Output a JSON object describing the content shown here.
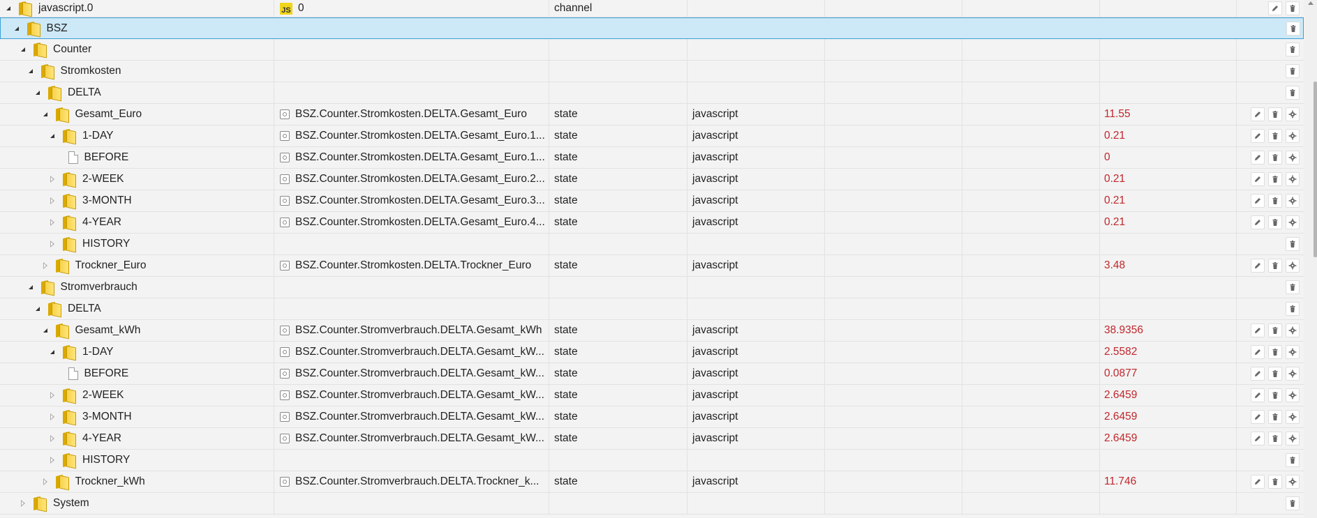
{
  "rows": [
    {
      "name": "javascript.0",
      "level": 0,
      "exp": "open",
      "icon": "folder",
      "idIcon": "js",
      "id": "0",
      "type": "channel",
      "role": "",
      "value": "",
      "buttons": [
        "edit",
        "delete"
      ],
      "first": true
    },
    {
      "name": "BSZ",
      "level": 1,
      "exp": "open",
      "icon": "folder",
      "id": "",
      "type": "",
      "role": "",
      "value": "",
      "buttons": [
        "delete"
      ],
      "selected": true
    },
    {
      "name": "Counter",
      "level": 2,
      "exp": "open",
      "icon": "folder",
      "id": "",
      "type": "",
      "role": "",
      "value": "",
      "buttons": [
        "delete"
      ]
    },
    {
      "name": "Stromkosten",
      "level": 3,
      "exp": "open",
      "icon": "folder",
      "id": "",
      "type": "",
      "role": "",
      "value": "",
      "buttons": [
        "delete"
      ]
    },
    {
      "name": "DELTA",
      "level": 4,
      "exp": "open",
      "icon": "folder",
      "id": "",
      "type": "",
      "role": "",
      "value": "",
      "buttons": [
        "delete"
      ]
    },
    {
      "name": "Gesamt_Euro",
      "level": 5,
      "exp": "open",
      "icon": "folder",
      "idIcon": "state",
      "id": "BSZ.Counter.Stromkosten.DELTA.Gesamt_Euro",
      "type": "state",
      "role": "javascript",
      "value": "11.55",
      "buttons": [
        "edit",
        "delete",
        "settings"
      ]
    },
    {
      "name": "1-DAY",
      "level": 6,
      "exp": "open",
      "icon": "folder",
      "idIcon": "state",
      "id": "BSZ.Counter.Stromkosten.DELTA.Gesamt_Euro.1...",
      "type": "state",
      "role": "javascript",
      "value": "0.21",
      "buttons": [
        "edit",
        "delete",
        "settings"
      ]
    },
    {
      "name": "BEFORE",
      "level": 7,
      "exp": "none",
      "icon": "file",
      "idIcon": "state",
      "id": "BSZ.Counter.Stromkosten.DELTA.Gesamt_Euro.1...",
      "type": "state",
      "role": "javascript",
      "value": "0",
      "buttons": [
        "edit",
        "delete",
        "settings"
      ]
    },
    {
      "name": "2-WEEK",
      "level": 6,
      "exp": "closed",
      "icon": "folder",
      "idIcon": "state",
      "id": "BSZ.Counter.Stromkosten.DELTA.Gesamt_Euro.2...",
      "type": "state",
      "role": "javascript",
      "value": "0.21",
      "buttons": [
        "edit",
        "delete",
        "settings"
      ]
    },
    {
      "name": "3-MONTH",
      "level": 6,
      "exp": "closed",
      "icon": "folder",
      "idIcon": "state",
      "id": "BSZ.Counter.Stromkosten.DELTA.Gesamt_Euro.3...",
      "type": "state",
      "role": "javascript",
      "value": "0.21",
      "buttons": [
        "edit",
        "delete",
        "settings"
      ]
    },
    {
      "name": "4-YEAR",
      "level": 6,
      "exp": "closed",
      "icon": "folder",
      "idIcon": "state",
      "id": "BSZ.Counter.Stromkosten.DELTA.Gesamt_Euro.4...",
      "type": "state",
      "role": "javascript",
      "value": "0.21",
      "buttons": [
        "edit",
        "delete",
        "settings"
      ]
    },
    {
      "name": "HISTORY",
      "level": 6,
      "exp": "closed",
      "icon": "folder",
      "id": "",
      "type": "",
      "role": "",
      "value": "",
      "buttons": [
        "delete"
      ]
    },
    {
      "name": "Trockner_Euro",
      "level": 5,
      "exp": "closed",
      "icon": "folder",
      "idIcon": "state",
      "id": "BSZ.Counter.Stromkosten.DELTA.Trockner_Euro",
      "type": "state",
      "role": "javascript",
      "value": "3.48",
      "buttons": [
        "edit",
        "delete",
        "settings"
      ]
    },
    {
      "name": "Stromverbrauch",
      "level": 3,
      "exp": "open",
      "icon": "folder",
      "id": "",
      "type": "",
      "role": "",
      "value": "",
      "buttons": [
        "delete"
      ]
    },
    {
      "name": "DELTA",
      "level": 4,
      "exp": "open",
      "icon": "folder",
      "id": "",
      "type": "",
      "role": "",
      "value": "",
      "buttons": [
        "delete"
      ]
    },
    {
      "name": "Gesamt_kWh",
      "level": 5,
      "exp": "open",
      "icon": "folder",
      "idIcon": "state",
      "id": "BSZ.Counter.Stromverbrauch.DELTA.Gesamt_kWh",
      "type": "state",
      "role": "javascript",
      "value": "38.9356",
      "buttons": [
        "edit",
        "delete",
        "settings"
      ]
    },
    {
      "name": "1-DAY",
      "level": 6,
      "exp": "open",
      "icon": "folder",
      "idIcon": "state",
      "id": "BSZ.Counter.Stromverbrauch.DELTA.Gesamt_kW...",
      "type": "state",
      "role": "javascript",
      "value": "2.5582",
      "buttons": [
        "edit",
        "delete",
        "settings"
      ]
    },
    {
      "name": "BEFORE",
      "level": 7,
      "exp": "none",
      "icon": "file",
      "idIcon": "state",
      "id": "BSZ.Counter.Stromverbrauch.DELTA.Gesamt_kW...",
      "type": "state",
      "role": "javascript",
      "value": "0.0877",
      "buttons": [
        "edit",
        "delete",
        "settings"
      ]
    },
    {
      "name": "2-WEEK",
      "level": 6,
      "exp": "closed",
      "icon": "folder",
      "idIcon": "state",
      "id": "BSZ.Counter.Stromverbrauch.DELTA.Gesamt_kW...",
      "type": "state",
      "role": "javascript",
      "value": "2.6459",
      "buttons": [
        "edit",
        "delete",
        "settings"
      ]
    },
    {
      "name": "3-MONTH",
      "level": 6,
      "exp": "closed",
      "icon": "folder",
      "idIcon": "state",
      "id": "BSZ.Counter.Stromverbrauch.DELTA.Gesamt_kW...",
      "type": "state",
      "role": "javascript",
      "value": "2.6459",
      "buttons": [
        "edit",
        "delete",
        "settings"
      ]
    },
    {
      "name": "4-YEAR",
      "level": 6,
      "exp": "closed",
      "icon": "folder",
      "idIcon": "state",
      "id": "BSZ.Counter.Stromverbrauch.DELTA.Gesamt_kW...",
      "type": "state",
      "role": "javascript",
      "value": "2.6459",
      "buttons": [
        "edit",
        "delete",
        "settings"
      ]
    },
    {
      "name": "HISTORY",
      "level": 6,
      "exp": "closed",
      "icon": "folder",
      "id": "",
      "type": "",
      "role": "",
      "value": "",
      "buttons": [
        "delete"
      ]
    },
    {
      "name": "Trockner_kWh",
      "level": 5,
      "exp": "closed",
      "icon": "folder",
      "idIcon": "state",
      "id": "BSZ.Counter.Stromverbrauch.DELTA.Trockner_k...",
      "type": "state",
      "role": "javascript",
      "value": "11.746",
      "buttons": [
        "edit",
        "delete",
        "settings"
      ]
    },
    {
      "name": "System",
      "level": 2,
      "exp": "closed",
      "icon": "folder",
      "id": "",
      "type": "",
      "role": "",
      "value": "",
      "buttons": [
        "delete"
      ]
    }
  ],
  "colors": {
    "selected_bg": "#cde8f6",
    "selected_border": "#3c9fd6",
    "value": "#c0262c",
    "folder": "#f7d24a"
  },
  "icons": {
    "edit": "pencil-icon",
    "delete": "trash-icon",
    "settings": "gear-icon"
  }
}
